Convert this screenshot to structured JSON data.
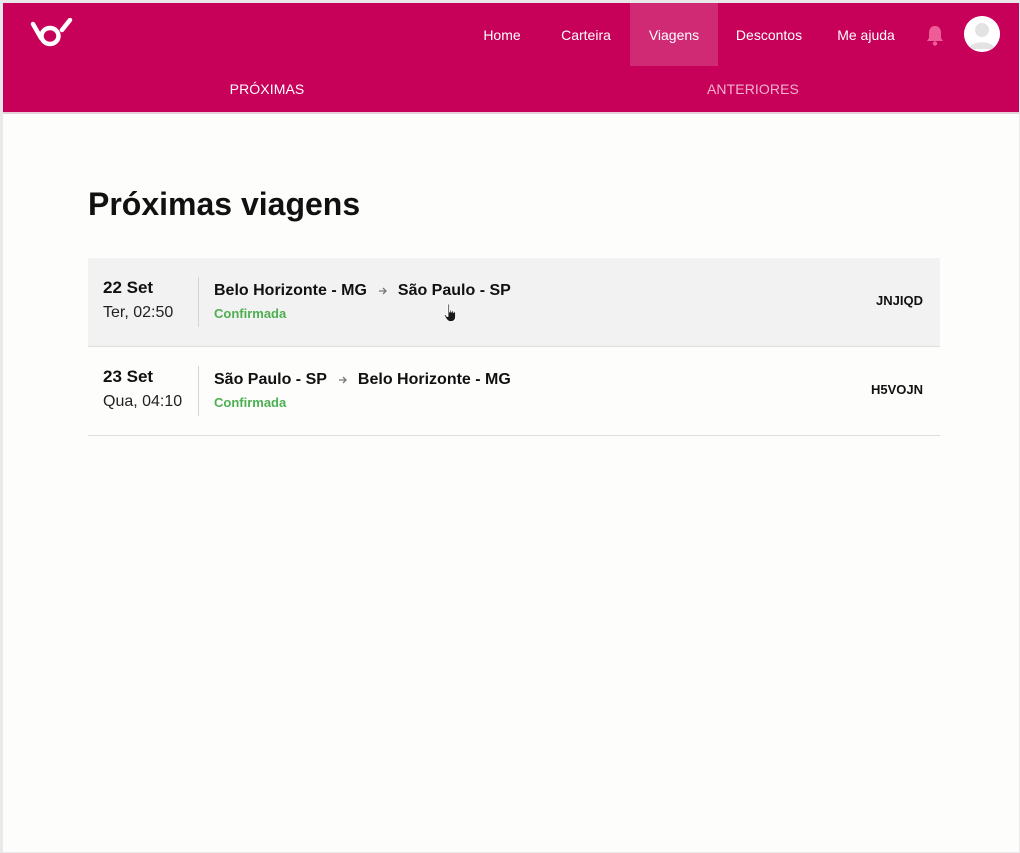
{
  "nav": {
    "items": [
      {
        "label": "Home",
        "active": false
      },
      {
        "label": "Carteira",
        "active": false
      },
      {
        "label": "Viagens",
        "active": true
      },
      {
        "label": "Descontos",
        "active": false
      },
      {
        "label": "Me ajuda",
        "active": false
      }
    ],
    "icons": [
      "logo-icon",
      "bell-icon",
      "avatar-icon"
    ]
  },
  "tabs": {
    "upcoming": "PRÓXIMAS",
    "previous": "ANTERIORES",
    "selected": "upcoming"
  },
  "main": {
    "title": "Próximas viagens",
    "trips": [
      {
        "day": "22 Set",
        "time": "Ter, 02:50",
        "origin": "Belo Horizonte - MG",
        "destination": "São Paulo - SP",
        "status": "Confirmada",
        "code": "JNJIQD"
      },
      {
        "day": "23 Set",
        "time": "Qua, 04:10",
        "origin": "São Paulo - SP",
        "destination": "Belo Horizonte - MG",
        "status": "Confirmada",
        "code": "H5VOJN"
      }
    ]
  },
  "colors": {
    "brand": "#c7005a",
    "nav_active": "#d12a74",
    "status_confirmed": "#4caf50",
    "row_hover": "#f3f2f2"
  }
}
